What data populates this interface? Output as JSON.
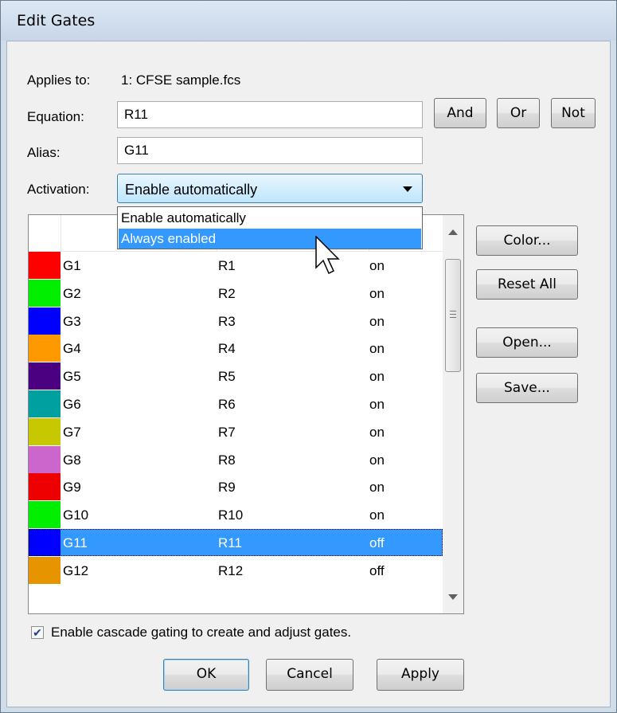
{
  "dialog": {
    "title": "Edit Gates"
  },
  "applies_to": {
    "label": "Applies to:",
    "value": "1: CFSE sample.fcs"
  },
  "equation": {
    "label": "Equation:",
    "value": "R11"
  },
  "alias": {
    "label": "Alias:",
    "value": "G11"
  },
  "activation": {
    "label": "Activation:",
    "value": "Enable automatically",
    "options": [
      "Enable automatically",
      "Always enabled"
    ],
    "highlighted_option": "Always enabled"
  },
  "operator_buttons": {
    "and": "And",
    "or": "Or",
    "not": "Not"
  },
  "side_buttons": {
    "color": "Color...",
    "reset_all": "Reset All",
    "open": "Open...",
    "save": "Save..."
  },
  "gates": [
    {
      "name": "G1",
      "region": "R1",
      "state": "on",
      "color": "#ff0000"
    },
    {
      "name": "G2",
      "region": "R2",
      "state": "on",
      "color": "#00ee00"
    },
    {
      "name": "G3",
      "region": "R3",
      "state": "on",
      "color": "#0000ff"
    },
    {
      "name": "G4",
      "region": "R4",
      "state": "on",
      "color": "#ff9900"
    },
    {
      "name": "G5",
      "region": "R5",
      "state": "on",
      "color": "#4b0082"
    },
    {
      "name": "G6",
      "region": "R6",
      "state": "on",
      "color": "#00a0a0"
    },
    {
      "name": "G7",
      "region": "R7",
      "state": "on",
      "color": "#c8c800"
    },
    {
      "name": "G8",
      "region": "R8",
      "state": "on",
      "color": "#cc66cc"
    },
    {
      "name": "G9",
      "region": "R9",
      "state": "on",
      "color": "#ee0000"
    },
    {
      "name": "G10",
      "region": "R10",
      "state": "on",
      "color": "#00ee00"
    },
    {
      "name": "G11",
      "region": "R11",
      "state": "off",
      "color": "#0000ff"
    },
    {
      "name": "G12",
      "region": "R12",
      "state": "off",
      "color": "#e69500"
    }
  ],
  "selected_gate": "G11",
  "cascade": {
    "checked": true,
    "label": "Enable cascade gating to create and adjust gates."
  },
  "footer_buttons": {
    "ok": "OK",
    "cancel": "Cancel",
    "apply": "Apply"
  }
}
